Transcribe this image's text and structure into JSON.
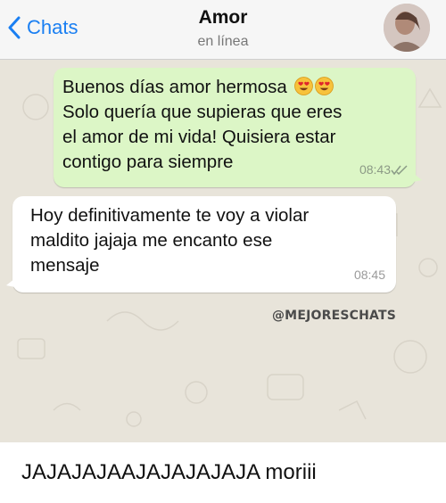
{
  "header": {
    "back_label": "Chats",
    "contact_name": "Amor",
    "status": "en línea"
  },
  "messages": [
    {
      "direction": "outgoing",
      "lines": [
        "Buenos días amor hermosa",
        "Solo quería que supieras que eres",
        "el amor de mi vida! Quisiera estar",
        "contigo para siempre"
      ],
      "emojis": [
        "heart-eyes-emoji",
        "heart-eyes-emoji"
      ],
      "time": "08:43",
      "read_receipt": "double-check-icon"
    },
    {
      "direction": "incoming",
      "lines": [
        "Hoy definitivamente te voy a violar",
        "maldito jajaja me encanto ese",
        "mensaje"
      ],
      "time": "08:45"
    }
  ],
  "watermark": "@MEJORESCHATS",
  "caption": "JAJAJAJAAJAJAJAJAJA moriii",
  "colors": {
    "accent": "#1a7ff2",
    "outgoing_bubble": "#dcf6c6",
    "incoming_bubble": "#ffffff",
    "chat_background": "#e8e4da"
  }
}
